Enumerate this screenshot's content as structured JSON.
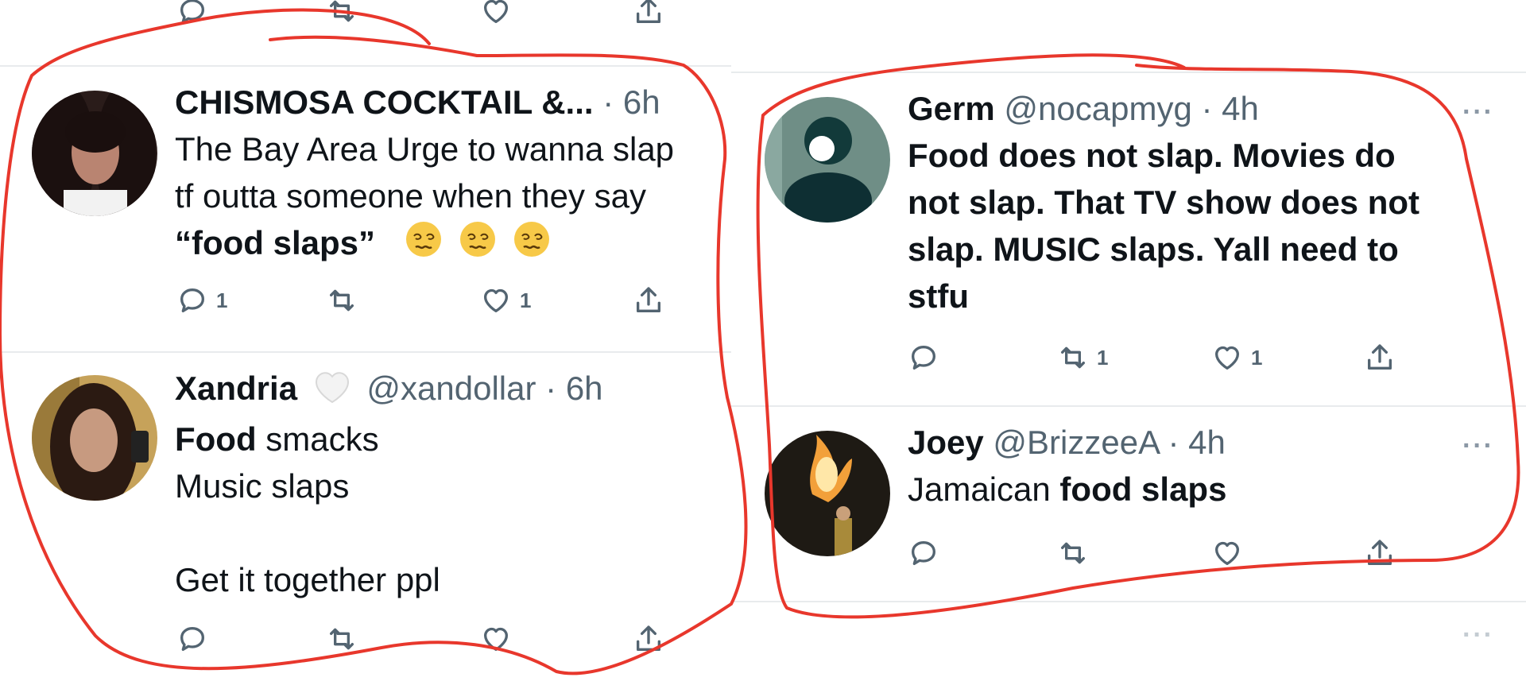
{
  "left_panel": {
    "top_actions": {
      "reply_count": "",
      "retweet_count": "",
      "like_count": ""
    },
    "tweets": [
      {
        "name": "CHISMOSA COCKTAIL &...",
        "handle": "",
        "dot": "·",
        "time": "6h",
        "lines": [
          "The Bay Area Urge to wanna slap",
          "tf outta someone when they say"
        ],
        "quote_text": "“food slaps”",
        "emoji_icon": "woozy-face-icon",
        "reply_count": "1",
        "retweet_count": "",
        "like_count": "1"
      },
      {
        "name": "Xandria",
        "badge_icon": "white-heart-icon",
        "handle": "@xandollar",
        "dot": "·",
        "time": "6h",
        "line1_bold": "Food",
        "line1_rest": " smacks",
        "line2": "Music slaps",
        "line3": "Get it together ppl",
        "reply_count": "",
        "retweet_count": "",
        "like_count": ""
      }
    ]
  },
  "right_panel": {
    "tweets": [
      {
        "name": "Germ",
        "handle": "@nocapmyg",
        "dot": "·",
        "time": "4h",
        "more": "···",
        "lines": [
          "Food does not slap. Movies do",
          "not slap. That TV show does not",
          "slap. MUSIC slaps. Yall need to",
          "stfu"
        ],
        "reply_count": "",
        "retweet_count": "1",
        "like_count": "1"
      },
      {
        "name": "Joey",
        "handle": "@BrizzeeA",
        "dot": "·",
        "time": "4h",
        "more": "···",
        "text_plain": "Jamaican ",
        "text_bold": "food slaps",
        "reply_count": "",
        "retweet_count": "",
        "like_count": ""
      }
    ]
  },
  "colors": {
    "text": "#0f1419",
    "muted": "#536471",
    "divider": "#e8ebed",
    "annotation": "#e8372c"
  }
}
